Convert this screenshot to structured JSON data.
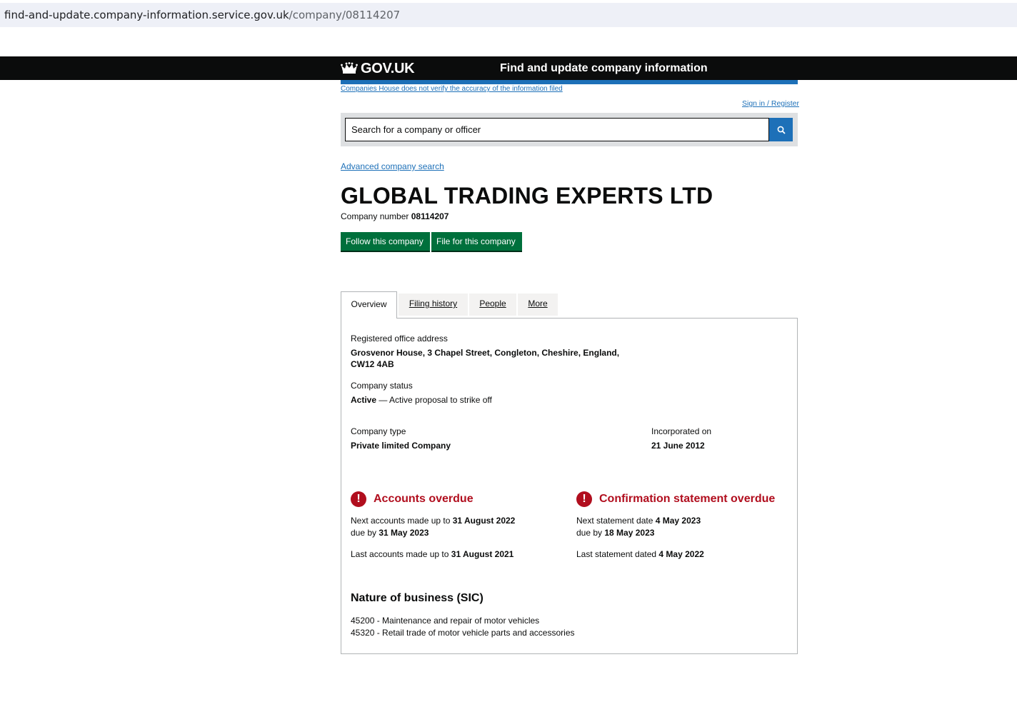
{
  "browser": {
    "url_host": "find-and-update.company-information.service.gov.uk",
    "url_path": "/company/08114207"
  },
  "header": {
    "logo": "GOV.UK",
    "service_name": "Find and update company information"
  },
  "disclaimer": "Companies House does not verify the accuracy of the information filed",
  "signin": "Sign in / Register",
  "search": {
    "placeholder": "Search for a company or officer",
    "icon": "search-icon"
  },
  "advanced_search": "Advanced company search",
  "company": {
    "name": "GLOBAL TRADING EXPERTS LTD",
    "number_label": "Company number",
    "number": "08114207"
  },
  "actions": {
    "follow": "Follow this company",
    "file": "File for this company"
  },
  "tabs": [
    {
      "label": "Overview"
    },
    {
      "label": "Filing history"
    },
    {
      "label": "People"
    },
    {
      "label": "More"
    }
  ],
  "overview": {
    "address_label": "Registered office address",
    "address_line1": "Grosvenor House, 3 Chapel Street, Congleton, Cheshire, England,",
    "address_line2": "CW12 4AB",
    "status_label": "Company status",
    "status_value": "Active",
    "status_note": " — Active proposal to strike off",
    "type_label": "Company type",
    "type_value": "Private limited Company",
    "incorporated_label": "Incorporated on",
    "incorporated_value": "21 June 2012"
  },
  "accounts": {
    "heading": "Accounts overdue",
    "next_prefix": "Next accounts made up to ",
    "next_date": "31 August 2022",
    "due_prefix": "due by ",
    "due_date": "31 May 2023",
    "last_prefix": "Last accounts made up to ",
    "last_date": "31 August 2021"
  },
  "confirmation": {
    "heading": "Confirmation statement overdue",
    "next_prefix": "Next statement date ",
    "next_date": "4 May 2023",
    "due_prefix": "due by ",
    "due_date": "18 May 2023",
    "last_prefix": "Last statement dated ",
    "last_date": "4 May 2022"
  },
  "sic": {
    "heading": "Nature of business (SIC)",
    "items": [
      "45200 - Maintenance and repair of motor vehicles",
      "45320 - Retail trade of motor vehicle parts and accessories"
    ]
  },
  "colors": {
    "link": "#1d70b8",
    "button_green": "#00703c",
    "warning_red": "#b10e1e",
    "header_black": "#0b0c0c"
  }
}
